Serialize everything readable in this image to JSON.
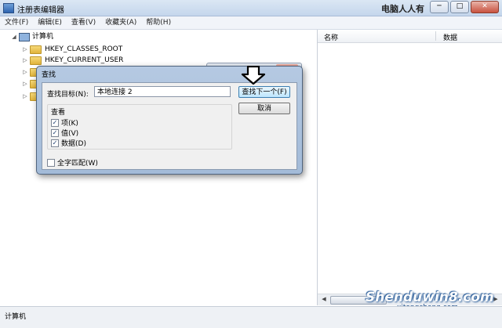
{
  "window": {
    "title": "注册表编辑器",
    "watermark": "电脑人人有",
    "buttons": {
      "minimize": "─",
      "maximize": "□",
      "close": "✕"
    }
  },
  "menu": [
    "文件(F)",
    "编辑(E)",
    "查看(V)",
    "收藏夹(A)",
    "帮助(H)"
  ],
  "tree": {
    "root": "计算机",
    "items": [
      "HKEY_CLASSES_ROOT",
      "HKEY_CURRENT_USER"
    ]
  },
  "values_pane": {
    "columns": {
      "name": "名称",
      "data": "数据"
    },
    "watermark_main": "Shenduwin8.com",
    "watermark_sub": "xitongcheng.com"
  },
  "status": {
    "text": "计算机"
  },
  "small_dialog": {
    "close": "✕"
  },
  "find_dialog": {
    "title": "查找",
    "target_label": "查找目标(N):",
    "target_value": "本地连接 2",
    "find_next_label": "查找下一个(F)",
    "cancel_label": "取消",
    "look_at_title": "查看",
    "options": [
      {
        "label": "项(K)",
        "checked": true
      },
      {
        "label": "值(V)",
        "checked": true
      },
      {
        "label": "数据(D)",
        "checked": true
      }
    ],
    "match_whole": {
      "label": "全字匹配(W)",
      "checked": false
    }
  }
}
